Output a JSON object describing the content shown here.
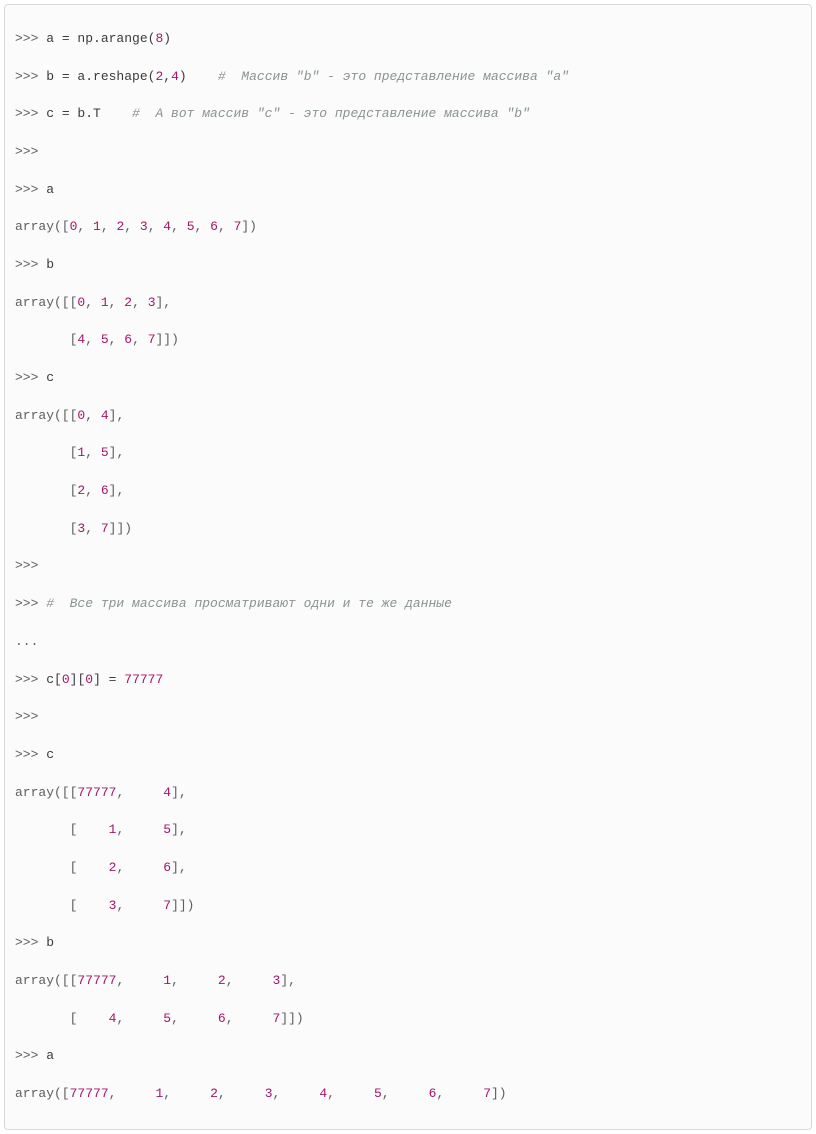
{
  "colors": {
    "border": "#d8d8d8",
    "bg": "#fbfbfb",
    "number": "#a31569",
    "comment": "#8a9393",
    "normal": "#5d6060"
  },
  "p": {
    "prm": ">>> ",
    "dot": "... "
  },
  "l": {
    "l1_assign": "a = np.arange(",
    "l1_num": "8",
    "l1_close": ")",
    "l2_assign": "b = a.reshape(",
    "l2_n1": "2",
    "l2_comma": ",",
    "l2_n2": "4",
    "l2_close": ")",
    "l2_space": "    ",
    "l2_comment": "#  Массив \"b\" - это представление массива \"a\"",
    "l3_assign": "c = b.T",
    "l3_space": "    ",
    "l3_comment": "#  А вот массив \"c\" - это представление массива \"b\"",
    "l5_a": "a",
    "l6_out_pre": "array([",
    "l6_nums": [
      "0",
      "1",
      "2",
      "3",
      "4",
      "5",
      "6",
      "7"
    ],
    "l6_out_post": "])",
    "l7_b": "b",
    "l8_out_pre": "array([[",
    "l8_nums1": [
      "0",
      "1",
      "2",
      "3"
    ],
    "l8_mid": "],",
    "l9_pre": "       [",
    "l9_nums2": [
      "4",
      "5",
      "6",
      "7"
    ],
    "l9_post": "]])",
    "l10_c": "c",
    "l11_out_pre": "array([[",
    "l11_pair1": [
      "0",
      "4"
    ],
    "l11_mid": "],",
    "l12_pre": "       [",
    "l12_pair": [
      "1",
      "5"
    ],
    "l12_post": "],",
    "l13_pre": "       [",
    "l13_pair": [
      "2",
      "6"
    ],
    "l13_post": "],",
    "l14_pre": "       [",
    "l14_pair": [
      "3",
      "7"
    ],
    "l14_post": "]])",
    "lcmt2": "#  Все три массива просматривают одни и те же данные",
    "l16_assign_a": "c[",
    "l16_i0": "0",
    "l16_b": "][",
    "l16_i1": "0",
    "l16_c": "] = ",
    "l16_val": "77777",
    "l18_c": "c",
    "l19_pre": "array([[",
    "l19_p": [
      "77777",
      "    4"
    ],
    "l19_mid": "],",
    "l20_pre": "       [",
    "l20_p": [
      "    1",
      "    5"
    ],
    "l20_post": "],",
    "l21_pre": "       [",
    "l21_p": [
      "    2",
      "    6"
    ],
    "l21_post": "],",
    "l22_pre": "       [",
    "l22_p": [
      "    3",
      "    7"
    ],
    "l22_post": "]])",
    "l23_b": "b",
    "l24_pre": "array([[",
    "l24_nums": [
      "77777",
      "    1",
      "    2",
      "    3"
    ],
    "l24_post": "],",
    "l25_pre": "       [",
    "l25_nums": [
      "    4",
      "    5",
      "    6",
      "    7"
    ],
    "l25_post": "]])",
    "l26_a": "a",
    "l27_pre": "array([",
    "l27_nums": [
      "77777",
      "    1",
      "    2",
      "    3",
      "    4",
      "    5",
      "    6",
      "    7"
    ],
    "l27_post": "])"
  }
}
